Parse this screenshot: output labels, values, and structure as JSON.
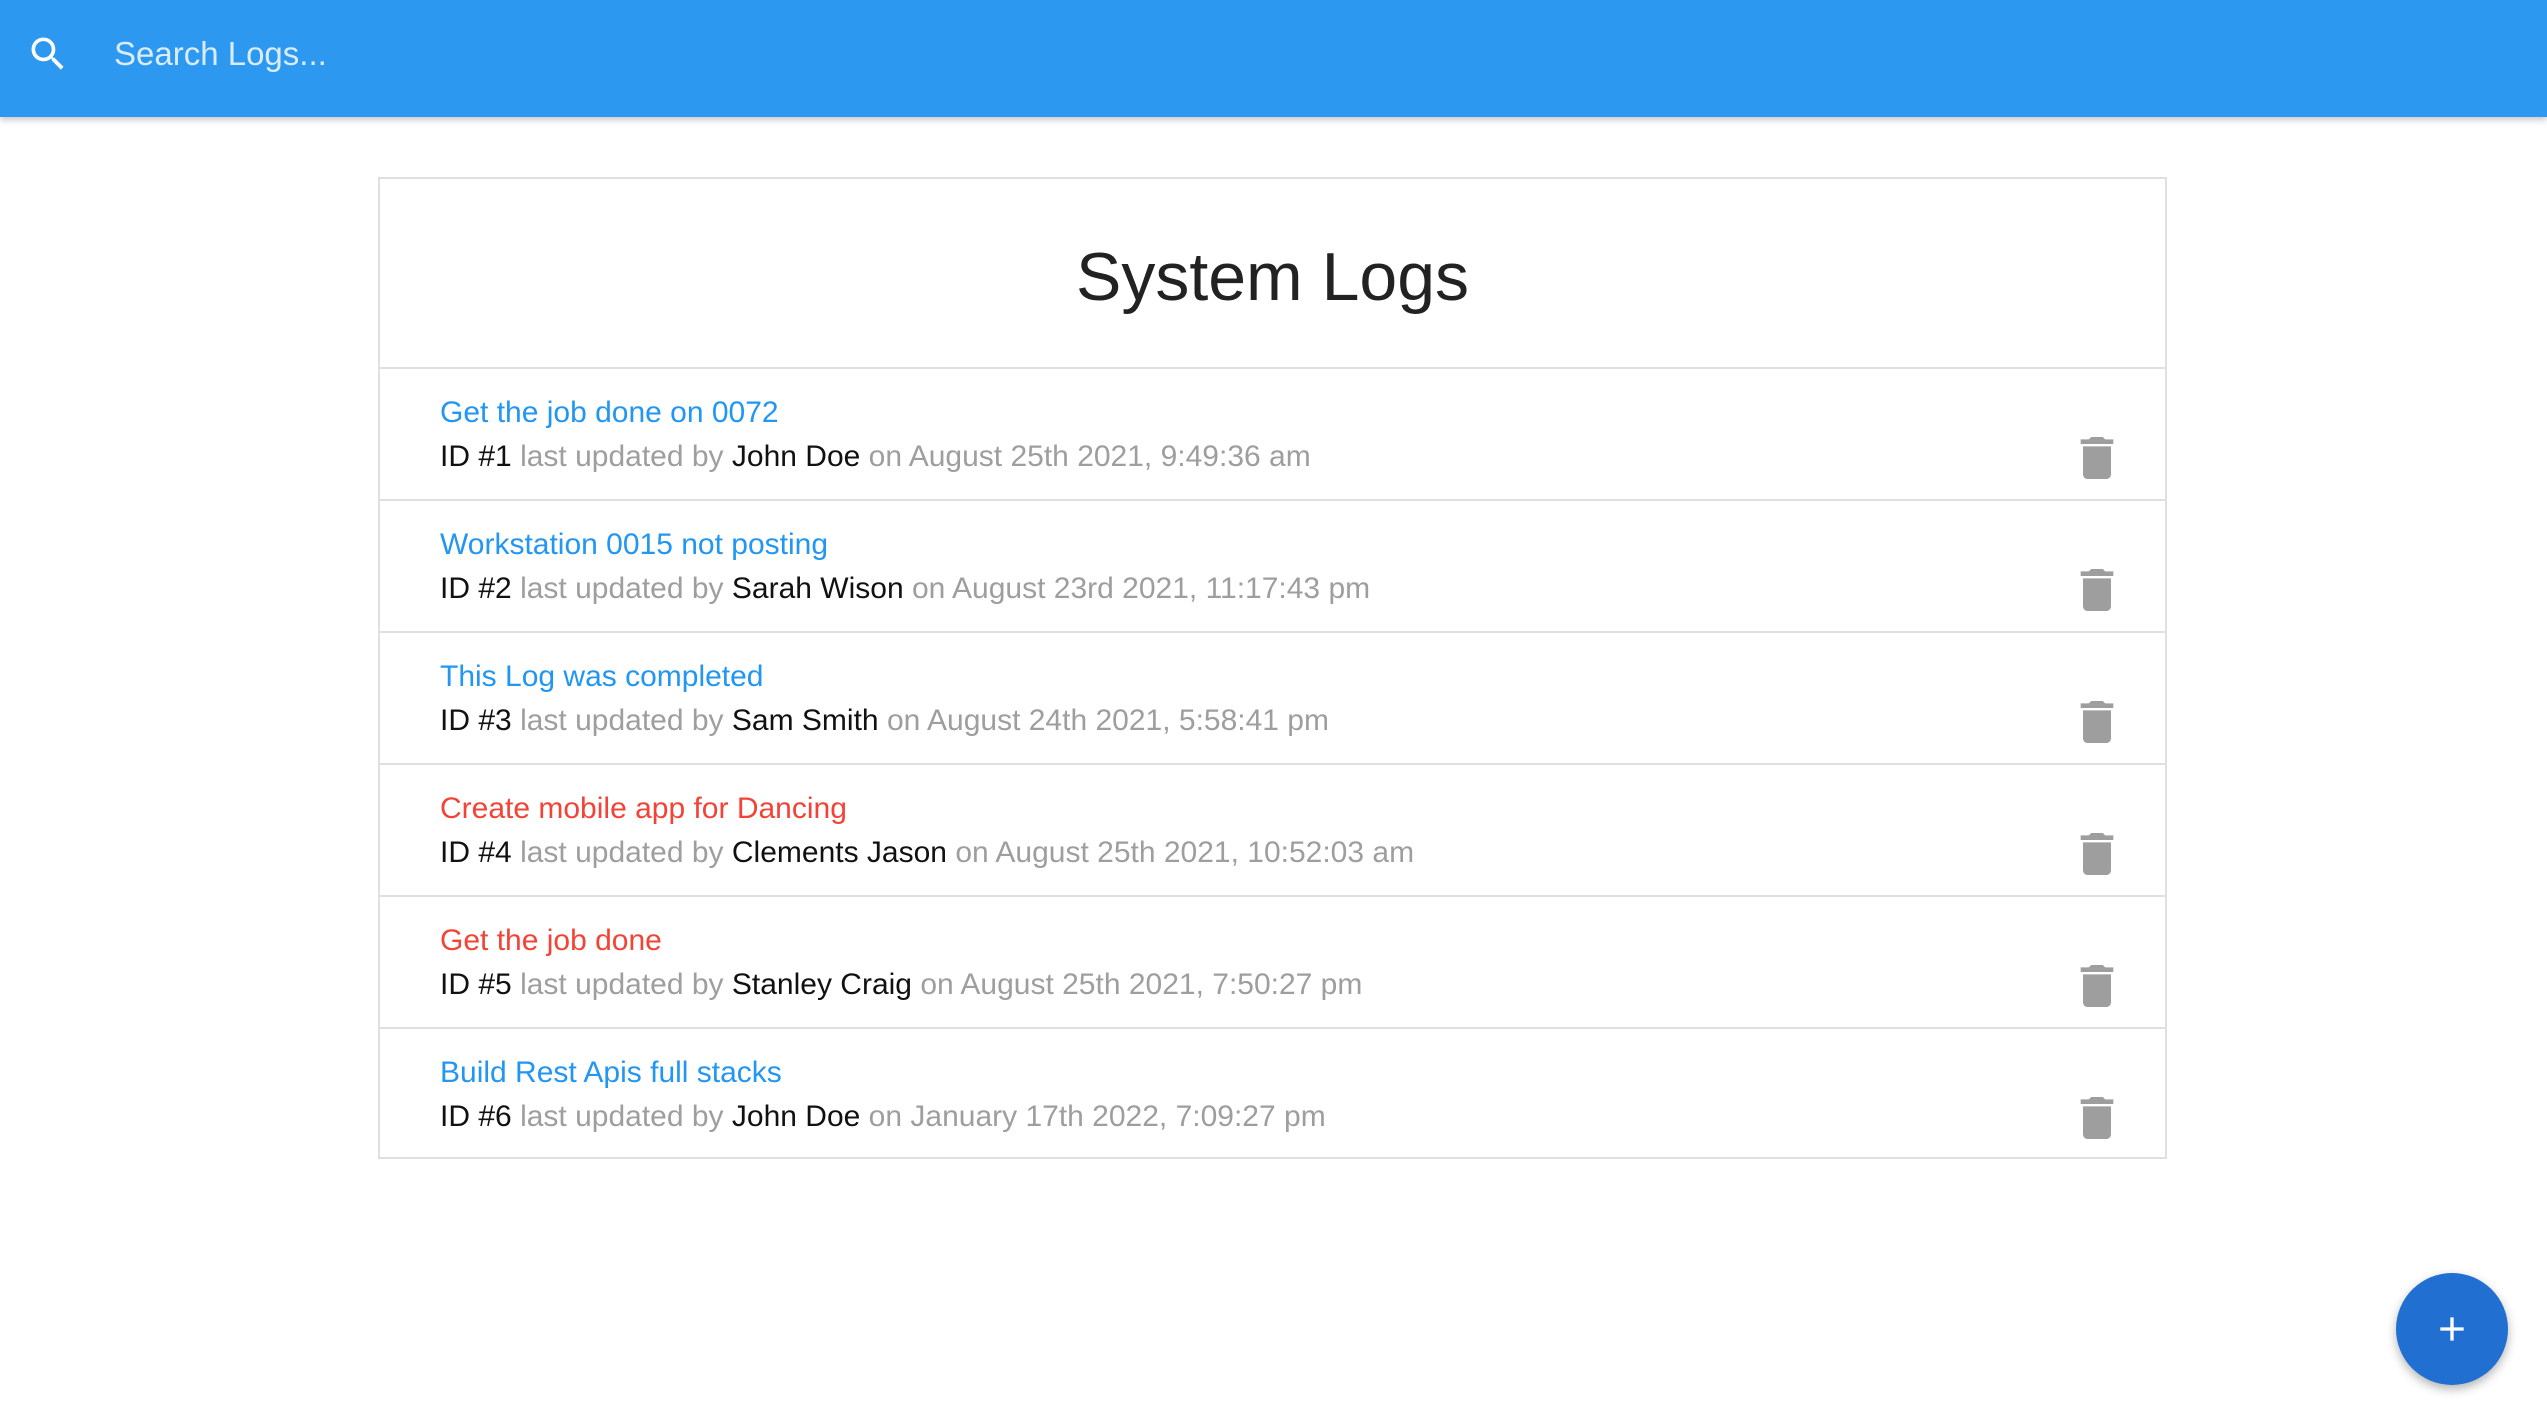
{
  "navbar": {
    "search_placeholder": "Search Logs...",
    "search_icon": "search-icon",
    "background_color": "#2c98ef"
  },
  "card": {
    "title": "System Logs"
  },
  "labels": {
    "id_prefix": "ID #",
    "updated_by": "last updated by",
    "on": "on"
  },
  "logs": [
    {
      "id": "1",
      "message": "Get the job done on 0072",
      "attention": false,
      "tech": "John Doe",
      "date": "August 25th 2021, 9:49:36 am"
    },
    {
      "id": "2",
      "message": "Workstation 0015 not posting",
      "attention": false,
      "tech": "Sarah Wison",
      "date": "August 23rd 2021, 11:17:43 pm"
    },
    {
      "id": "3",
      "message": "This Log was completed",
      "attention": false,
      "tech": "Sam Smith",
      "date": "August 24th 2021, 5:58:41 pm"
    },
    {
      "id": "4",
      "message": "Create mobile app for Dancing",
      "attention": true,
      "tech": "Clements Jason",
      "date": "August 25th 2021, 10:52:03 am"
    },
    {
      "id": "5",
      "message": "Get the job done",
      "attention": true,
      "tech": "Stanley Craig",
      "date": "August 25th 2021, 7:50:27 pm"
    },
    {
      "id": "6",
      "message": "Build Rest Apis full stacks",
      "attention": false,
      "tech": "John Doe",
      "date": "January 17th 2022, 7:09:27 pm"
    }
  ],
  "fab": {
    "icon": "plus-icon",
    "color": "#2170d1"
  },
  "colors": {
    "link_normal": "#2196f3",
    "link_attention": "#f44336",
    "meta_grey": "#9e9e9e",
    "delete_icon": "#9e9e9e"
  }
}
